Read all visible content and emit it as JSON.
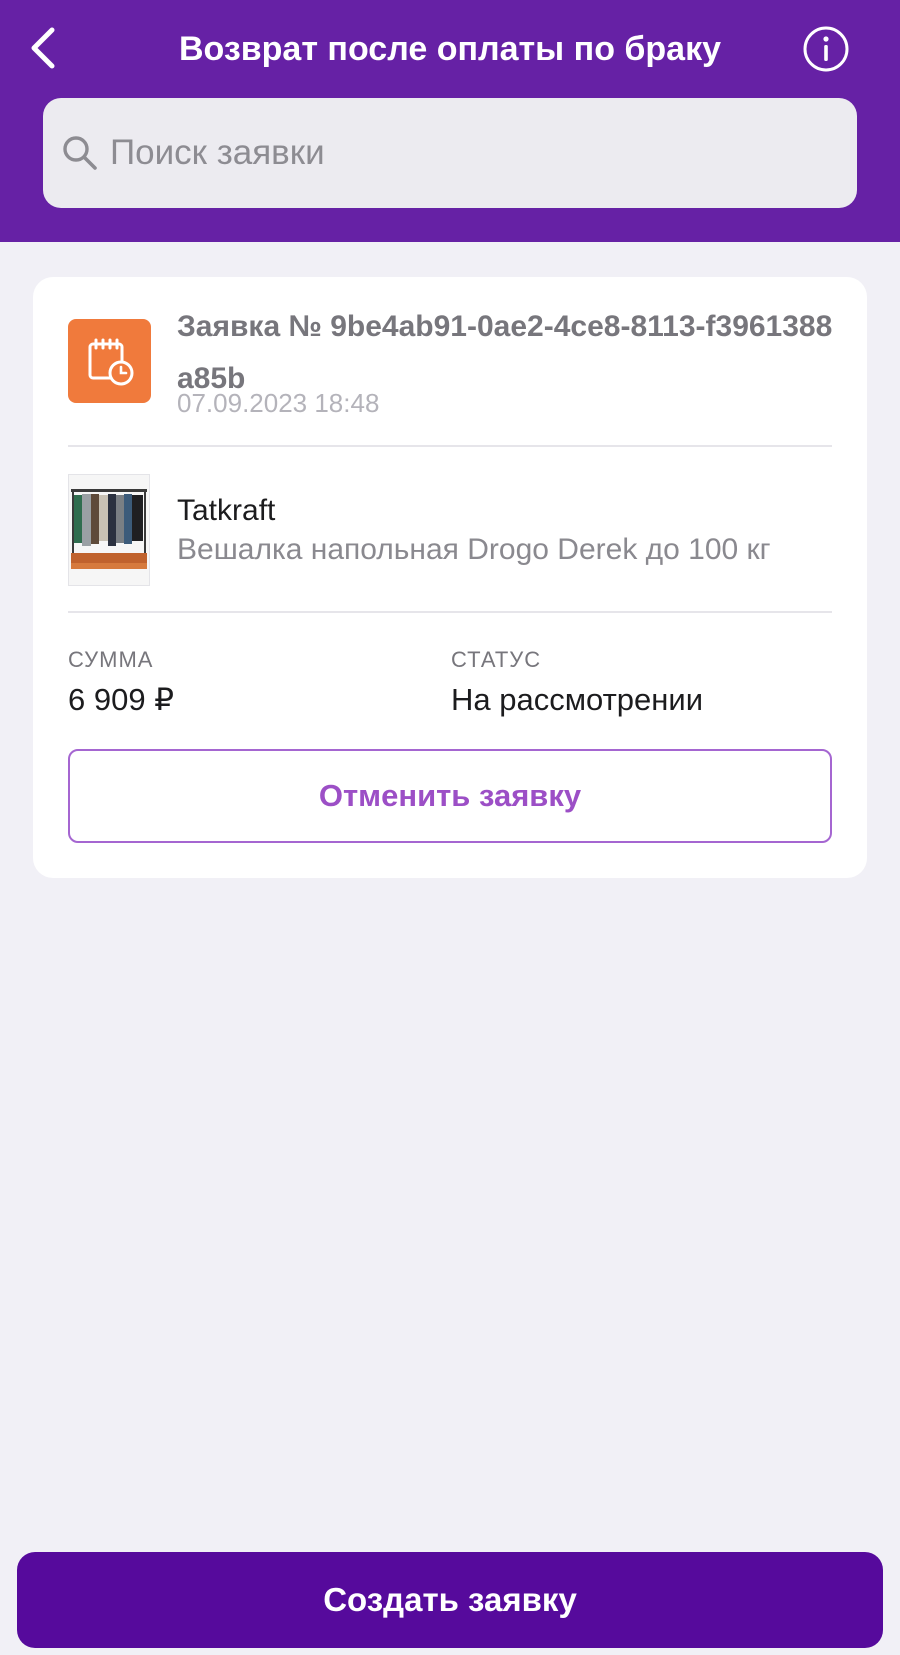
{
  "header": {
    "title": "Возврат после оплаты по браку",
    "back_icon": "chevron-left-icon",
    "info_icon": "info-icon",
    "background_color": "#6621a5"
  },
  "search": {
    "placeholder": "Поиск заявки",
    "value": "",
    "icon": "search-icon"
  },
  "request": {
    "icon": "calendar-clock-icon",
    "icon_color": "#f07a3c",
    "number": "Заявка № 9be4ab91-0ae2-4ce8-8113-f3961388a85b",
    "date": "07.09.2023 18:48",
    "product": {
      "brand": "Tatkraft",
      "name": "Вешалка напольная Drogo Derek до 100 кг",
      "image": "clothes-rack-thumbnail"
    },
    "amount_label": "СУММА",
    "amount_value": "6 909 ₽",
    "status_label": "СТАТУС",
    "status_value": "На рассмотрении",
    "cancel_label": "Отменить заявку"
  },
  "footer": {
    "create_label": "Создать заявку",
    "button_color": "#560a9c"
  }
}
